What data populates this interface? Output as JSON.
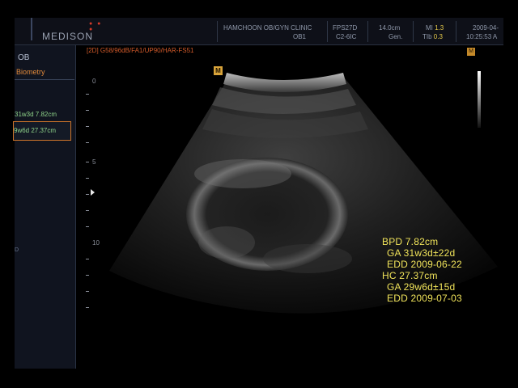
{
  "header": {
    "brand": "MEDISON",
    "brand_dots": "● ● ●",
    "clinic": "HAMCHOON OB/GYN CLINIC",
    "application": "OB1",
    "probe_fps": "FPS27D",
    "probe": "C2-6IC",
    "depth": "14.0cm",
    "mode": "Gen.",
    "mi_label": "MI",
    "mi_value": "1.3",
    "tib_label": "TIb",
    "tib_value": "0.3",
    "date": "2009-04-",
    "time": "10:25:53 A"
  },
  "left_panel": {
    "title": "OB",
    "section": "Biometry",
    "bpd_entry": "31w3d  7.82cm",
    "hc_entry": "9w6d  27.37cm",
    "footer_char": "D"
  },
  "image_info": "[2D] G58/96dB/FA1/UP90/HAR-FS51",
  "depth_scale": {
    "labels": [
      "0",
      "5",
      "10"
    ]
  },
  "markers": {
    "focus": "M",
    "corner": "M"
  },
  "results": {
    "bpd": "BPD 7.82cm",
    "bpd_ga": "GA 31w3d±22d",
    "bpd_edd": "EDD 2009-06-22",
    "hc": "HC  27.37cm",
    "hc_ga": "GA 29w6d±15d",
    "hc_edd": "EDD 2009-07-03"
  },
  "colors": {
    "result_text": "#f0e35a",
    "accent_orange": "#d0762a",
    "entry_green": "#8fd48a"
  }
}
